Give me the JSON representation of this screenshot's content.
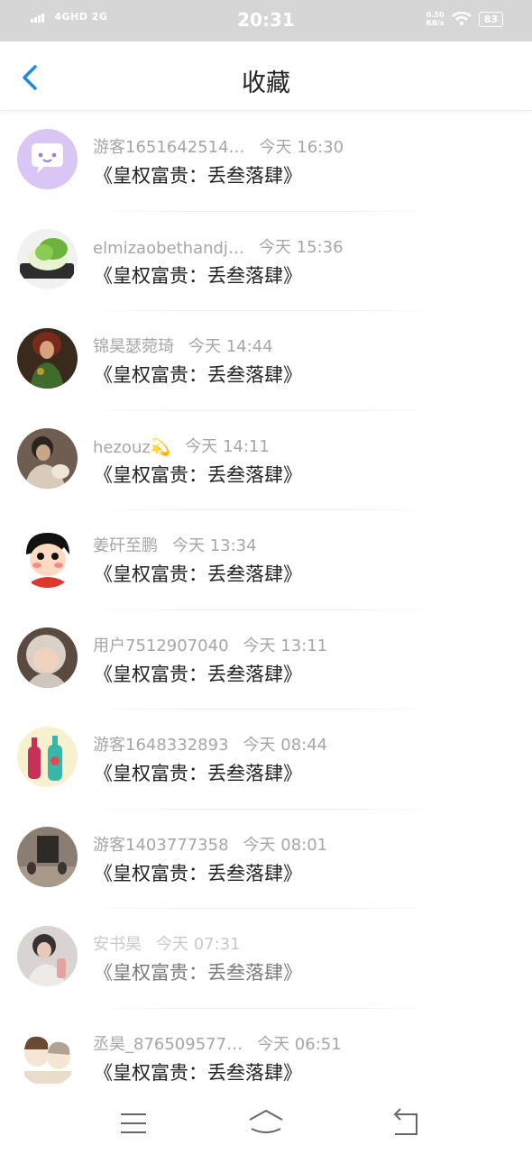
{
  "status_bar": {
    "network_left": "4GHD 2G",
    "time": "20:31",
    "net_speed_value": "0.50",
    "net_speed_unit": "KB/s",
    "battery": "83",
    "icons": [
      "signal-icon",
      "wifi-icon",
      "battery-icon"
    ]
  },
  "header": {
    "title": "收藏",
    "back_icon": "chevron-left-icon",
    "accent": "#1e88e5"
  },
  "items": [
    {
      "user": "游客1651642514…",
      "time": "今天 16:30",
      "content": "《皇权富贵：丢叁落肆》"
    },
    {
      "user": "elmizaobethandj…",
      "time": "今天 15:36",
      "content": "《皇权富贵：丢叁落肆》"
    },
    {
      "user": "锦昊瑟菀琦",
      "time": "今天 14:44",
      "content": "《皇权富贵：丢叁落肆》"
    },
    {
      "user": "hezouz💫",
      "time": "今天 14:11",
      "content": "《皇权富贵：丢叁落肆》"
    },
    {
      "user": "姜矸至鹏",
      "time": "今天 13:34",
      "content": "《皇权富贵：丢叁落肆》"
    },
    {
      "user": "用户7512907040",
      "time": "今天 13:11",
      "content": "《皇权富贵：丢叁落肆》"
    },
    {
      "user": "游客1648332893",
      "time": "今天 08:44",
      "content": "《皇权富贵：丢叁落肆》"
    },
    {
      "user": "游客1403777358",
      "time": "今天 08:01",
      "content": "《皇权富贵：丢叁落肆》"
    },
    {
      "user": "安书昊",
      "time": "今天 07:31",
      "content": "《皇权富贵：丢叁落肆》"
    },
    {
      "user": "丞昊_876509577…",
      "time": "今天 06:51",
      "content": "《皇权富贵：丢叁落肆》"
    }
  ],
  "nav": {
    "icons": [
      "menu-icon",
      "home-icon",
      "back-icon"
    ]
  }
}
